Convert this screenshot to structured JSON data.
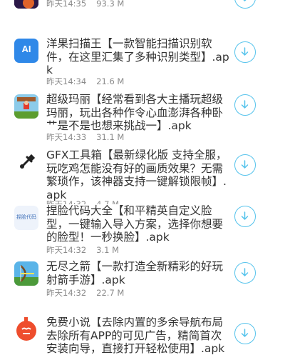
{
  "top_partial": {
    "time": "昨天14:35",
    "size": "93.3 M"
  },
  "apps": [
    {
      "title": "洋果扫描王【一款智能扫描识别软件，在这里汇集了多种识别类型】.apk",
      "time": "昨天14:34",
      "size": "21.6 M",
      "icon": "ai-scanner-icon",
      "icon_text": "AI"
    },
    {
      "title": "超级玛丽【经常看到各大主播玩超级玛丽，玩出各种作令心血澎湃各种卧艹是不是也想来挑战一】.apk",
      "time": "昨天14:33",
      "size": "31.1 M",
      "icon": "mario-game-icon"
    },
    {
      "title": "GFX工具箱【最新绿化版 支持全服，玩吃鸡怎能没有好的画质效果？无需繁琐作，该神器支持一键解锁限帧】.apk",
      "time": "昨天14:32",
      "size": "4.7 M",
      "icon": "gfx-tool-icon"
    },
    {
      "title": "捏脸代码大全【和平精英自定义脸型，一键输入导入方案，选择你想要的脸型！一秒换脸】.apk",
      "time": "昨天14:32",
      "size": "3.1 M",
      "icon": "face-code-icon",
      "icon_text": "捏脸代码"
    },
    {
      "title": "无尽之箭【一款打造全新精彩的好玩射箭手游】.apk",
      "time": "昨天14:32",
      "size": "22.7 M",
      "icon": "archer-game-icon"
    },
    {
      "title": "免费小说【去除内置的多余导航布局去除所有APP的可见广告，精简首次安装向导，直接打开轻松使用】.apk",
      "time": "",
      "size": "",
      "icon": "novel-app-icon"
    }
  ],
  "colors": {
    "accent": "#55c3ec",
    "meta": "#8a8a8a"
  }
}
